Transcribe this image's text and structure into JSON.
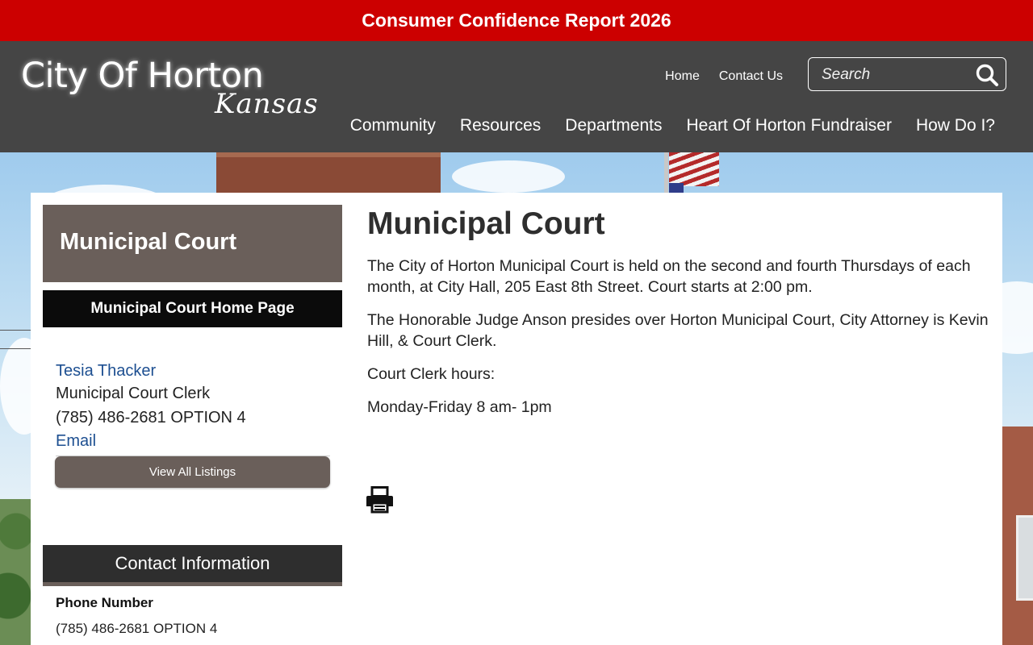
{
  "alert": {
    "text": "Consumer Confidence Report 2026"
  },
  "header": {
    "logo_main": "City Of Horton",
    "logo_sub": "Kansas",
    "util_links": [
      "Home",
      "Contact Us"
    ],
    "search_placeholder": "Search",
    "nav": [
      "Community",
      "Resources",
      "Departments",
      "Heart Of Horton Fundraiser",
      "How Do I?"
    ]
  },
  "sidebar": {
    "title": "Municipal Court",
    "home_link": "Municipal Court Home Page",
    "contact": {
      "name": "Tesia Thacker",
      "role": "Municipal Court Clerk",
      "phone": "(785) 486-2681 OPTION 4",
      "email_label": "Email"
    },
    "view_all": "View All Listings",
    "contact_info_title": "Contact Information",
    "phone_label": "Phone Number",
    "phone_value": "(785) 486-2681 OPTION 4"
  },
  "main": {
    "title": "Municipal Court",
    "paragraphs": [
      "The City of Horton Municipal Court is held on the second and fourth Thursdays of each month, at City Hall, 205 East 8th Street. Court starts at 2:00 pm.",
      "The Honorable Judge Anson presides over Horton Municipal Court, City Attorney is Kevin Hill, & Court Clerk.",
      "Court Clerk hours:",
      "Monday-Friday 8 am- 1pm"
    ]
  },
  "icons": {
    "search": "search-icon",
    "print": "print-icon"
  },
  "colors": {
    "alert_bg": "#cc0000",
    "header_bg": "#454545",
    "sidebar_accent": "#6a5f5a",
    "link": "#1d4f91"
  }
}
